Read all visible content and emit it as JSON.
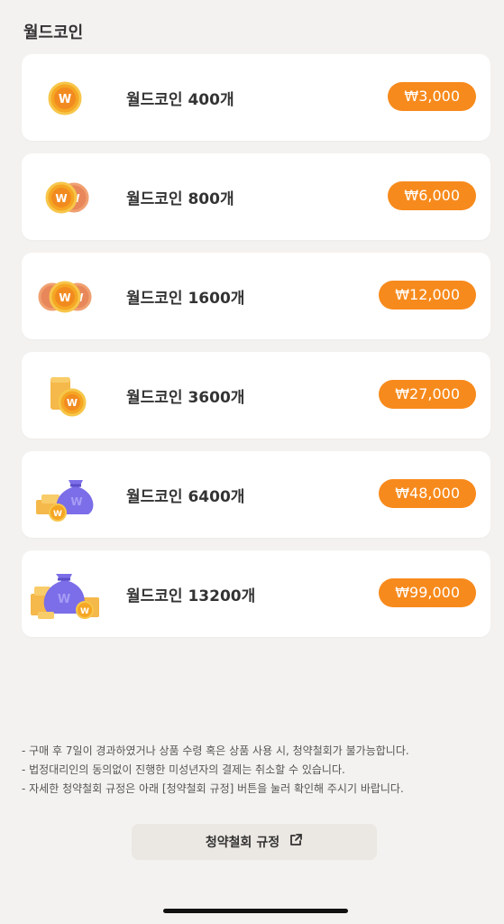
{
  "section_title": "월드코인",
  "products": [
    {
      "label": "월드코인 400개",
      "price": "₩3,000",
      "icon": "single-coin-icon"
    },
    {
      "label": "월드코인 800개",
      "price": "₩6,000",
      "icon": "two-coins-icon"
    },
    {
      "label": "월드코인 1600개",
      "price": "₩12,000",
      "icon": "three-coins-icon"
    },
    {
      "label": "월드코인 3600개",
      "price": "₩27,000",
      "icon": "coin-stack-icon"
    },
    {
      "label": "월드코인 6400개",
      "price": "₩48,000",
      "icon": "coin-bag-icon"
    },
    {
      "label": "월드코인 13200개",
      "price": "₩99,000",
      "icon": "coin-bag-large-icon"
    }
  ],
  "notices": [
    "- 구매 후 7일이 경과하였거나 상품 수령 혹은 상품 사용 시, 청약철회가 불가능합니다.",
    "- 법정대리인의 동의없이 진행한 미성년자의 결제는 취소할 수 있습니다.",
    "- 자세한 청약철회 규정은 아래 [청약철회 규정] 버튼을 눌러 확인해 주시기 바랍니다."
  ],
  "refund_button_label": "청약철회 규정",
  "colors": {
    "accent": "#f78a1c",
    "background": "#f4f2f0",
    "card": "#ffffff",
    "button_bg": "#ebe7e3",
    "bag_purple": "#7b6ee8"
  }
}
